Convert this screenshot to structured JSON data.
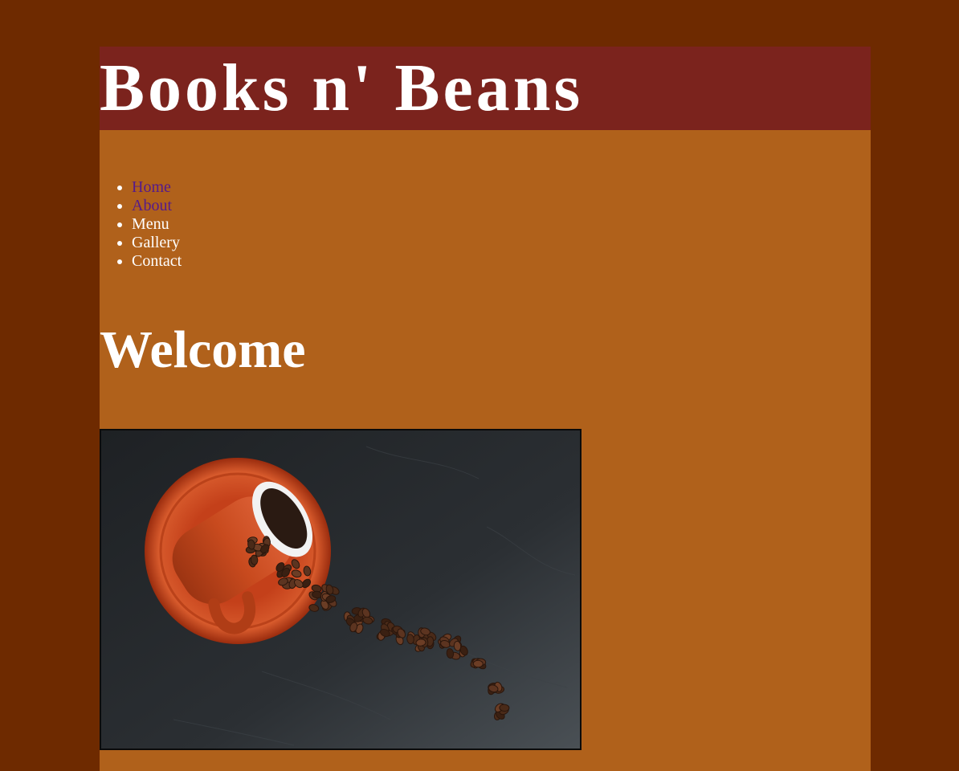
{
  "site": {
    "title": "Books n' Beans"
  },
  "nav": {
    "items": [
      {
        "label": "Home"
      },
      {
        "label": "About"
      },
      {
        "label": "Menu"
      },
      {
        "label": "Gallery"
      },
      {
        "label": "Contact"
      }
    ]
  },
  "main": {
    "heading": "Welcome"
  },
  "colors": {
    "outer_background": "#6e2a00",
    "page_background": "#b0611b",
    "masthead_background": "#7b231d",
    "visited_link": "#551a8b",
    "text": "#ffffff"
  }
}
